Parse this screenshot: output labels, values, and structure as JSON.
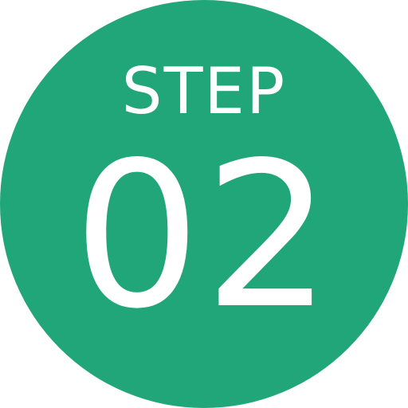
{
  "badge": {
    "label": "STEP",
    "number": "02",
    "background_color": "#21a67a",
    "text_color": "#ffffff"
  }
}
